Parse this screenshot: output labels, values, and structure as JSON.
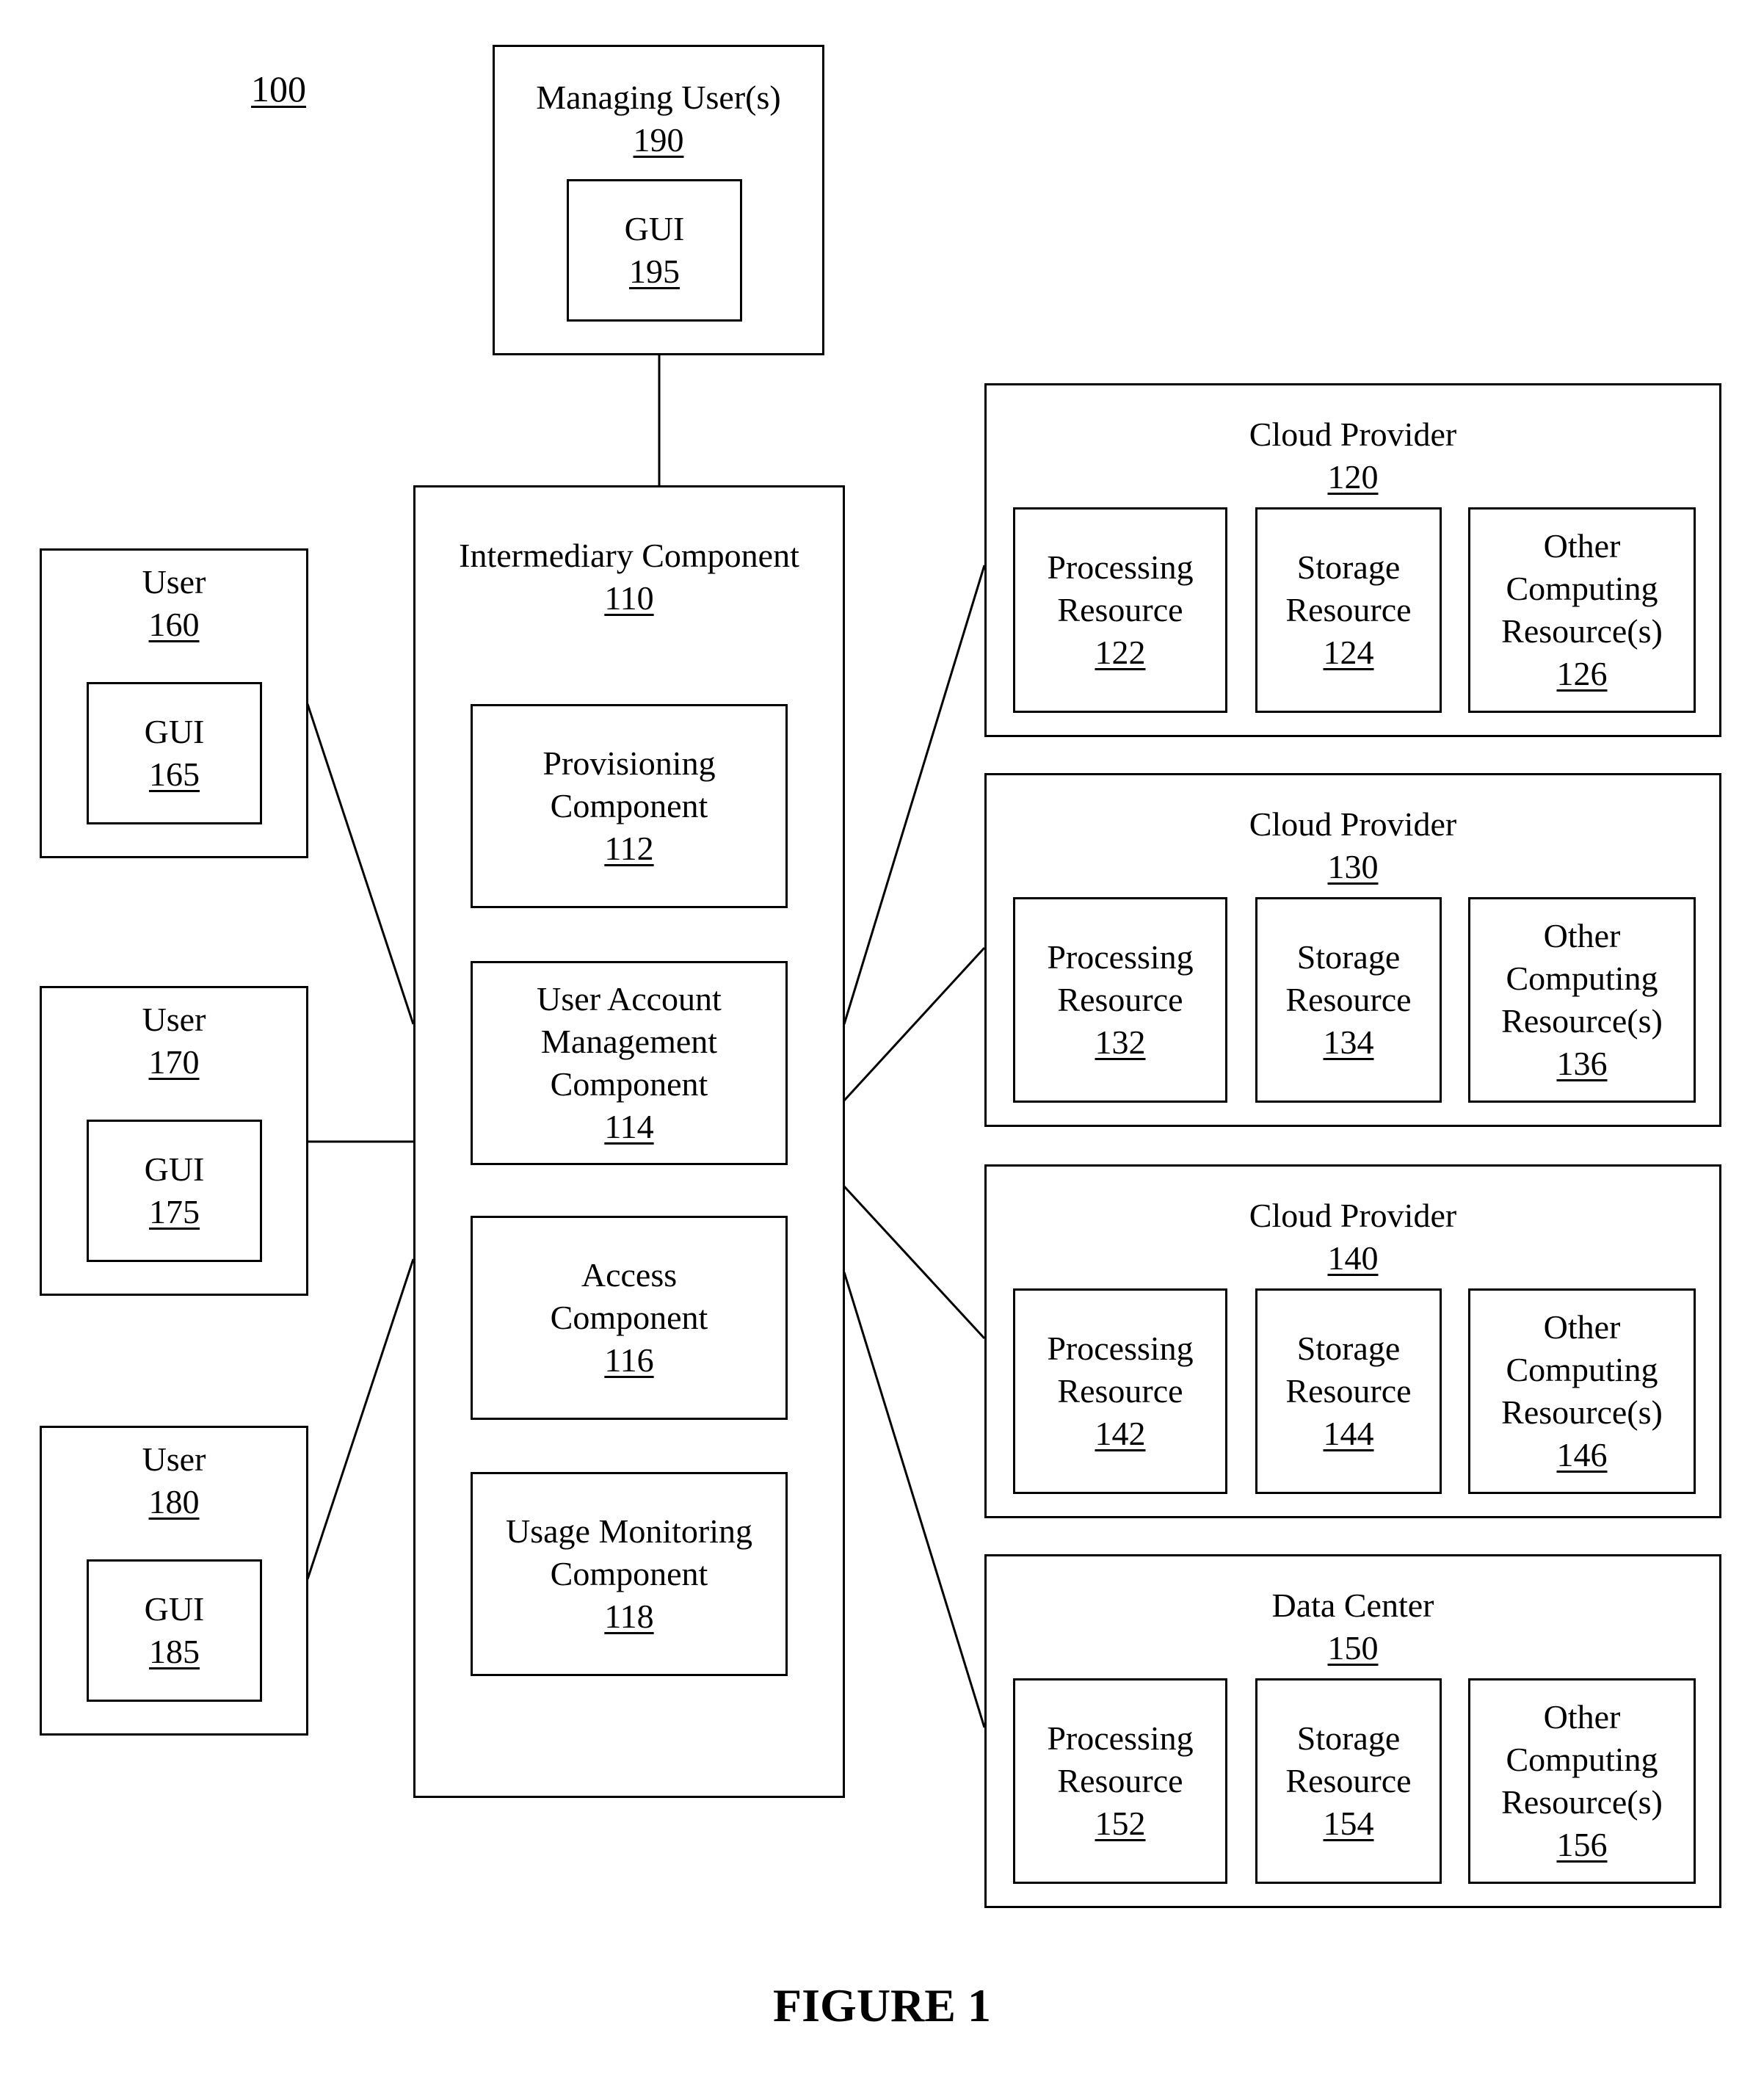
{
  "figure": {
    "reference": "100",
    "caption": "FIGURE 1"
  },
  "managing_user": {
    "label": "Managing User(s)",
    "number": "190",
    "gui": {
      "label": "GUI",
      "number": "195"
    }
  },
  "intermediary": {
    "label": "Intermediary Component",
    "number": "110",
    "components": [
      {
        "lines": [
          "Provisioning",
          "Component"
        ],
        "number": "112"
      },
      {
        "lines": [
          "User Account",
          "Management",
          "Component"
        ],
        "number": "114"
      },
      {
        "lines": [
          "Access",
          "Component"
        ],
        "number": "116"
      },
      {
        "lines": [
          "Usage Monitoring",
          "Component"
        ],
        "number": "118"
      }
    ]
  },
  "users": [
    {
      "label": "User",
      "number": "160",
      "gui": {
        "label": "GUI",
        "number": "165"
      }
    },
    {
      "label": "User",
      "number": "170",
      "gui": {
        "label": "GUI",
        "number": "175"
      }
    },
    {
      "label": "User",
      "number": "180",
      "gui": {
        "label": "GUI",
        "number": "185"
      }
    }
  ],
  "providers": [
    {
      "label": "Cloud Provider",
      "number": "120",
      "resources": [
        {
          "lines": [
            "Processing",
            "Resource"
          ],
          "number": "122"
        },
        {
          "lines": [
            "Storage",
            "Resource"
          ],
          "number": "124"
        },
        {
          "lines": [
            "Other",
            "Computing",
            "Resource(s)"
          ],
          "number": "126"
        }
      ]
    },
    {
      "label": "Cloud Provider",
      "number": "130",
      "resources": [
        {
          "lines": [
            "Processing",
            "Resource"
          ],
          "number": "132"
        },
        {
          "lines": [
            "Storage",
            "Resource"
          ],
          "number": "134"
        },
        {
          "lines": [
            "Other",
            "Computing",
            "Resource(s)"
          ],
          "number": "136"
        }
      ]
    },
    {
      "label": "Cloud Provider",
      "number": "140",
      "resources": [
        {
          "lines": [
            "Processing",
            "Resource"
          ],
          "number": "142"
        },
        {
          "lines": [
            "Storage",
            "Resource"
          ],
          "number": "144"
        },
        {
          "lines": [
            "Other",
            "Computing",
            "Resource(s)"
          ],
          "number": "146"
        }
      ]
    },
    {
      "label": "Data Center",
      "number": "150",
      "resources": [
        {
          "lines": [
            "Processing",
            "Resource"
          ],
          "number": "152"
        },
        {
          "lines": [
            "Storage",
            "Resource"
          ],
          "number": "154"
        },
        {
          "lines": [
            "Other",
            "Computing",
            "Resource(s)"
          ],
          "number": "156"
        }
      ]
    }
  ]
}
